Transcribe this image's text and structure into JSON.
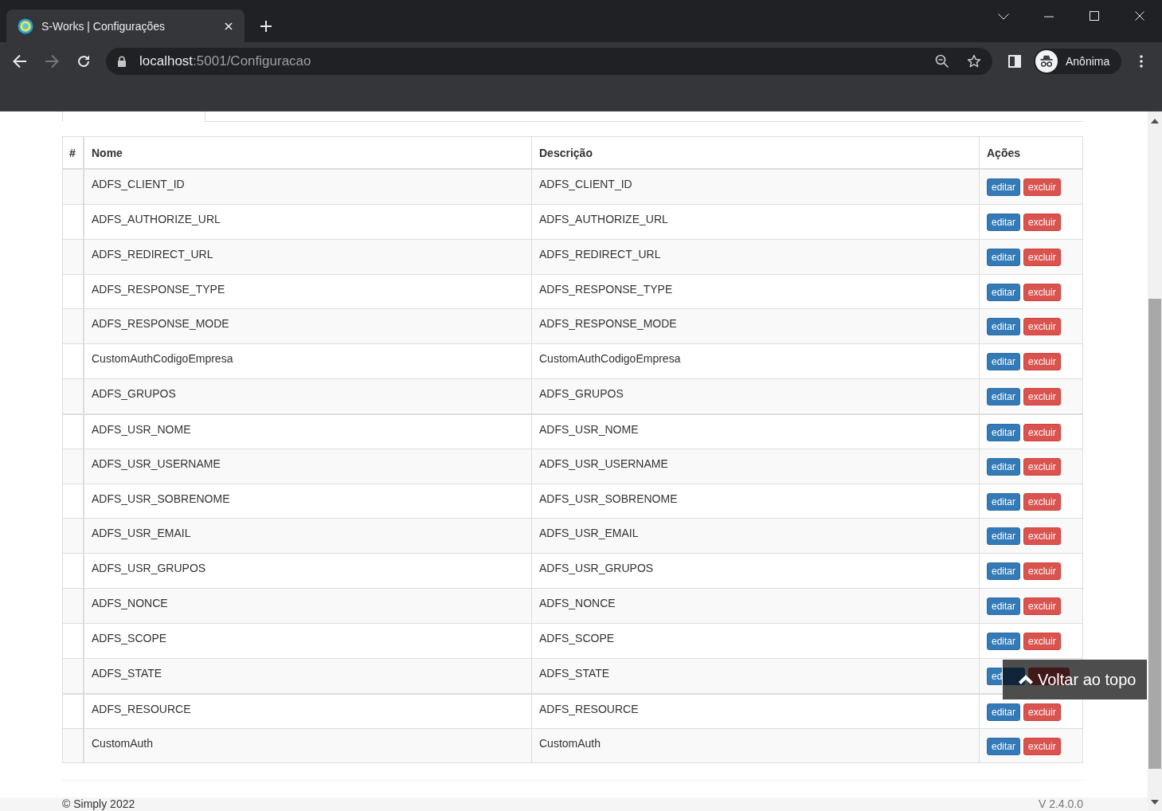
{
  "browser": {
    "tabs": [
      {
        "title": "S-Works | Configurações",
        "selected": true
      }
    ],
    "navigation": {
      "back": {
        "disabled": false
      },
      "forward": {
        "disabled": true
      }
    },
    "address_bar": {
      "host": "localhost",
      "rest": ":5001/Configuracao"
    },
    "profile": {
      "label": "Anônima"
    }
  },
  "table": {
    "columns": [
      "#",
      "Nome",
      "Descrição",
      "Ações"
    ],
    "groups": [
      {
        "rows": [
          {
            "nome": "ADFS_CLIENT_ID",
            "descricao": "ADFS_CLIENT_ID",
            "actions": [
              {
                "kind": "edit",
                "label": "editar"
              },
              {
                "kind": "delete",
                "label": "excluir"
              }
            ]
          },
          {
            "nome": "ADFS_AUTHORIZE_URL",
            "descricao": "ADFS_AUTHORIZE_URL",
            "actions": [
              {
                "kind": "edit",
                "label": "editar"
              },
              {
                "kind": "delete",
                "label": "excluir"
              }
            ]
          },
          {
            "nome": "ADFS_REDIRECT_URL",
            "descricao": "ADFS_REDIRECT_URL",
            "actions": [
              {
                "kind": "edit",
                "label": "editar"
              },
              {
                "kind": "delete",
                "label": "excluir"
              }
            ]
          },
          {
            "nome": "ADFS_RESPONSE_TYPE",
            "descricao": "ADFS_RESPONSE_TYPE",
            "actions": [
              {
                "kind": "edit",
                "label": "editar"
              },
              {
                "kind": "delete",
                "label": "excluir"
              }
            ]
          },
          {
            "nome": "ADFS_RESPONSE_MODE",
            "descricao": "ADFS_RESPONSE_MODE",
            "actions": [
              {
                "kind": "edit",
                "label": "editar"
              },
              {
                "kind": "delete",
                "label": "excluir"
              }
            ]
          },
          {
            "nome": "CustomAuthCodigoEmpresa",
            "descricao": "CustomAuthCodigoEmpresa",
            "actions": [
              {
                "kind": "edit",
                "label": "editar"
              },
              {
                "kind": "delete",
                "label": "excluir"
              }
            ]
          },
          {
            "nome": "ADFS_GRUPOS",
            "descricao": "ADFS_GRUPOS",
            "actions": [
              {
                "kind": "edit",
                "label": "editar"
              },
              {
                "kind": "delete",
                "label": "excluir"
              }
            ]
          }
        ]
      },
      {
        "rows": [
          {
            "nome": "ADFS_USR_NOME",
            "descricao": "ADFS_USR_NOME",
            "actions": [
              {
                "kind": "edit",
                "label": "editar"
              },
              {
                "kind": "delete",
                "label": "excluir"
              }
            ]
          },
          {
            "nome": "ADFS_USR_USERNAME",
            "descricao": "ADFS_USR_USERNAME",
            "actions": [
              {
                "kind": "edit",
                "label": "editar"
              },
              {
                "kind": "delete",
                "label": "excluir"
              }
            ]
          },
          {
            "nome": "ADFS_USR_SOBRENOME",
            "descricao": "ADFS_USR_SOBRENOME",
            "actions": [
              {
                "kind": "edit",
                "label": "editar"
              },
              {
                "kind": "delete",
                "label": "excluir"
              }
            ]
          },
          {
            "nome": "ADFS_USR_EMAIL",
            "descricao": "ADFS_USR_EMAIL",
            "actions": [
              {
                "kind": "edit",
                "label": "editar"
              },
              {
                "kind": "delete",
                "label": "excluir"
              }
            ]
          },
          {
            "nome": "ADFS_USR_GRUPOS",
            "descricao": "ADFS_USR_GRUPOS",
            "actions": [
              {
                "kind": "edit",
                "label": "editar"
              },
              {
                "kind": "delete",
                "label": "excluir"
              }
            ]
          },
          {
            "nome": "ADFS_NONCE",
            "descricao": "ADFS_NONCE",
            "actions": [
              {
                "kind": "edit",
                "label": "editar"
              },
              {
                "kind": "delete",
                "label": "excluir"
              }
            ]
          },
          {
            "nome": "ADFS_SCOPE",
            "descricao": "ADFS_SCOPE",
            "actions": [
              {
                "kind": "edit",
                "label": "editar"
              },
              {
                "kind": "delete",
                "label": "excluir"
              }
            ]
          },
          {
            "nome": "ADFS_STATE",
            "descricao": "ADFS_STATE",
            "actions": [
              {
                "kind": "edit",
                "label": "ed",
                "cut_off": true
              }
            ]
          }
        ]
      },
      {
        "rows": [
          {
            "nome": "ADFS_RESOURCE",
            "descricao": "ADFS_RESOURCE",
            "actions": [
              {
                "kind": "edit",
                "label": "editar"
              },
              {
                "kind": "delete",
                "label": "excluir"
              }
            ]
          },
          {
            "nome": "CustomAuth",
            "descricao": "CustomAuth",
            "actions": [
              {
                "kind": "edit",
                "label": "editar"
              },
              {
                "kind": "delete",
                "label": "excluir"
              }
            ]
          }
        ]
      }
    ]
  },
  "back_to_top": {
    "label": "Voltar ao topo"
  },
  "footer": {
    "copyright": "© Simply 2022",
    "version": "V 2.4.0.0"
  }
}
